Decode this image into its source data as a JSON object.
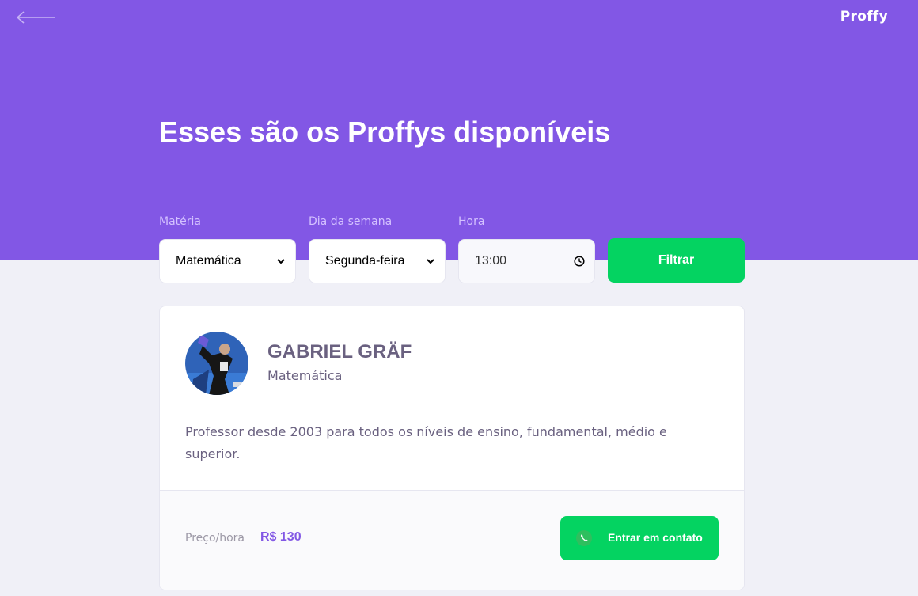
{
  "header": {
    "logo": "Proffy",
    "title": "Esses são os Proffys disponíveis"
  },
  "filters": {
    "subject_label": "Matéria",
    "subject_value": "Matemática",
    "weekday_label": "Dia da semana",
    "weekday_value": "Segunda-feira",
    "time_label": "Hora",
    "time_value": "13:00",
    "submit_label": "Filtrar"
  },
  "teacher": {
    "name": "GABRIEL GRÄF",
    "subject": "Matemática",
    "bio": "Professor desde 2003 para todos os níveis de ensino, fundamental, médio e superior.",
    "price_label": "Preço/hora",
    "price_value": "R$ 130",
    "contact_label": "Entrar em contato"
  },
  "icons": {
    "back": "arrow-left-icon",
    "chevron": "chevron-down-icon",
    "clock": "clock-icon",
    "whatsapp": "whatsapp-icon"
  },
  "colors": {
    "primary": "#8257e5",
    "secondary": "#04d361",
    "background": "#f0f0f7",
    "text": "#6a6180"
  }
}
